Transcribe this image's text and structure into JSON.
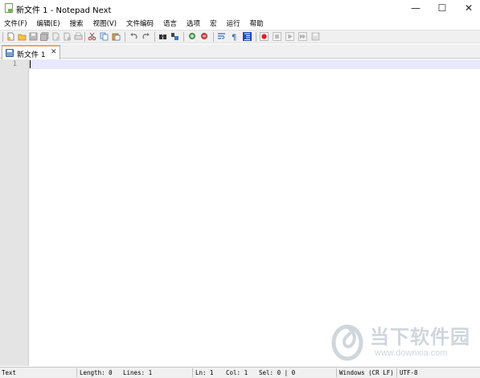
{
  "window": {
    "title": "新文件 1 - Notepad Next",
    "minimize_glyph": "—",
    "maximize_glyph": "☐",
    "close_glyph": "✕"
  },
  "menu": {
    "items": [
      "文件(F)",
      "编辑(E)",
      "搜索",
      "视图(V)",
      "文件编码",
      "语言",
      "选项",
      "宏",
      "运行",
      "帮助"
    ]
  },
  "toolbar": {
    "icons": [
      "new-file",
      "open-file",
      "save",
      "save-all",
      "close",
      "close-all",
      "cut",
      "copy",
      "paste",
      "undo",
      "redo",
      "find",
      "replace",
      "zoom-in",
      "zoom-out",
      "word-wrap",
      "show-all-characters",
      "indent-guide",
      "macro-record",
      "macro-stop",
      "macro-play",
      "macro-run-multiple",
      "macro-save"
    ]
  },
  "tabs": [
    {
      "label": "新文件 1",
      "close_glyph": "✕",
      "active": true
    }
  ],
  "editor": {
    "line_numbers": [
      "1"
    ],
    "content": "",
    "current_line_color": "#e8e8ff"
  },
  "statusbar": {
    "language": "Text",
    "length": "Length: 0",
    "lines": "Lines: 1",
    "ln": "Ln: 1",
    "col": "Col: 1",
    "sel": "Sel: 0 | 0",
    "eol": "Windows (CR LF)",
    "encoding": "UTF-8"
  },
  "watermark": {
    "title": "当下软件园",
    "url": "www.downxia.com"
  },
  "colors": {
    "tab_accent": "#f4a460",
    "gutter": "#e4e4e4",
    "toolbar_bg": "#f0f0f0"
  }
}
